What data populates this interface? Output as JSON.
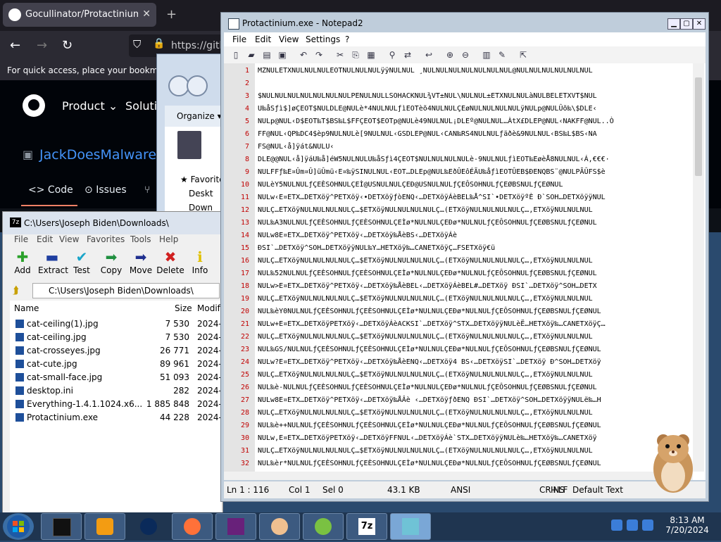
{
  "browser": {
    "tab_title": "Gocullinator/Protactinium.exe",
    "new_tab": "+",
    "url": "https://gith",
    "bookmarks_hint": "For quick access, place your bookmarks",
    "github": {
      "product": "Product",
      "solutions": "Solutio",
      "repo_owner": "JackDoesMalwares",
      "tabs": [
        "Code",
        "Issues"
      ]
    }
  },
  "explorer": {
    "organize": "Organize",
    "favorites": "Favorite",
    "desktop": "Deskt",
    "downloads": "Down"
  },
  "zip": {
    "title": "C:\\Users\\Joseph Biden\\Downloads\\",
    "icon_text": "7z",
    "menu": [
      "File",
      "Edit",
      "View",
      "Favorites",
      "Tools",
      "Help"
    ],
    "tools": [
      {
        "label": "Add",
        "icon": "plus-icon",
        "color": "#2aa12a"
      },
      {
        "label": "Extract",
        "icon": "minus-icon",
        "color": "#1f3fa0"
      },
      {
        "label": "Test",
        "icon": "check-icon",
        "color": "#1aa5c9"
      },
      {
        "label": "Copy",
        "icon": "copy-arrow-icon",
        "color": "#1f8f3f"
      },
      {
        "label": "Move",
        "icon": "move-arrow-icon",
        "color": "#1f2f8f"
      },
      {
        "label": "Delete",
        "icon": "delete-x-icon",
        "color": "#d02020"
      },
      {
        "label": "Info",
        "icon": "info-icon",
        "color": "#e0c000"
      }
    ],
    "path": "C:\\Users\\Joseph Biden\\Downloads\\",
    "columns": {
      "name": "Name",
      "size": "Size",
      "modified": "Modif"
    },
    "files": [
      {
        "name": "cat-ceiling(1).jpg",
        "size": "7 530",
        "date": "2024-"
      },
      {
        "name": "cat-ceiling.jpg",
        "size": "7 530",
        "date": "2024-"
      },
      {
        "name": "cat-crosseyes.jpg",
        "size": "26 771",
        "date": "2024-"
      },
      {
        "name": "cat-cute.jpg",
        "size": "89 961",
        "date": "2024-"
      },
      {
        "name": "cat-small-face.jpg",
        "size": "51 093",
        "date": "2024-"
      },
      {
        "name": "desktop.ini",
        "size": "282",
        "date": "2024-"
      },
      {
        "name": "Everything-1.4.1.1024.x6...",
        "size": "1 885 848",
        "date": "2024-"
      },
      {
        "name": "Protactinium.exe",
        "size": "44 228",
        "date": "2024-"
      }
    ]
  },
  "notepad": {
    "title": "Protactinium.exe - Notepad2",
    "menu": [
      "File",
      "Edit",
      "View",
      "Settings",
      "?"
    ],
    "lines": [
      {
        "n": "1",
        "text": "MZNULETXNULNULNULEOTNULNULNULÿÿNULNUL ¸NULNULNULNULNULNULNUL@NULNULNULNULNULNUL"
      },
      {
        "n": "2",
        "text": ""
      },
      {
        "n": "3",
        "text": "$NULNULNULNULNULNULNULPENULNULLSOHACKNUL¾VT±NUL\\NULNUL±ETXNULNULàNULBELETXVT$NUL"
      },
      {
        "n": "4",
        "text": "U‰åSƒì$]øÇEOT$NULDLE@NULè*4NULNULƒìEOTèõ4NULNULÇEøNULNULNULNULÿNULp@NULÛõ‰\\$DLE‹"
      },
      {
        "n": "5",
        "text": "NULp@NUL‹D$EOT‰T$BS‰L$FFÇEOT$EOTp@NULè49NULNUL¡DLEº@NULNUL…ÀtX£DLEP@NUL‹NAKFF@NUL..Ò"
      },
      {
        "n": "6",
        "text": "FF@NUL‹QP‰DC4$èp9NULNULè[9NULNUL‹GSDLEP@NUL‹CAN‰RS4NULNULƒäðè&9NULNUL‹BS‰L$BS‹NA"
      },
      {
        "n": "7",
        "text": "FS@NUL‹å]ÿát&NULU‹"
      },
      {
        "n": "8",
        "text": "DLE@@NUL‹å]ÿáU‰å]éW5NULNULU‰åSƒì4ÇEOT$NULNULNULNULè-9NULNULƒìEOT‰EøèÅ8NULNUL‹Á,€€€·"
      },
      {
        "n": "9",
        "text": "NULFFƒ‰E¤Ûm¤Û]üÛmü‹E¤‰ÿSINULNUL‹EOT…DLEp@NUL‰EðÛEôÉÃU‰åƒìEOTÛEB$ÐENQBS¨@NULPÃÛFS$è"
      },
      {
        "n": "10",
        "text": "NULèY5NULNULƒÇEÈSOHNULÇEÌ@USNULNULÇEÐ@USNULNULƒÇEÔSOHNULƒÇEØBSNULƒÇEØNUL"
      },
      {
        "n": "11",
        "text": "NULw‹E¤ETX…DETXöÿ^PETXöÿ‹•DETXöÿƒòENQ‹…DETXöÿÁèBEL‰Å^SI`•DETXöÿºÈ Ð`SOH…DETXöÿÿNUL"
      },
      {
        "n": "12",
        "text": "NULÇ…ETXöÿNULNULNULNULÇ…$ETXöÿNULNULNULNULÇ…(ETXöÿNULNULNULNULÇ…,ETXöÿNULNULNUL"
      },
      {
        "n": "13",
        "text": "NUL‰A3NULNULƒÇEÈSOHNULƒÇEÈSOHNULÇEÌø*NULNULÇEÐø*NULNULƒÇEÔSOHNULƒÇEØBSNULƒÇEØNUL"
      },
      {
        "n": "14",
        "text": "NULw8E¤ETX…DETXöÿ^PETXöÿ‹…DETXöÿ‰ÅèBS‹…DETXöÿÁè"
      },
      {
        "n": "15",
        "text": "   ÐSI`…DETXöÿ^SOH…DETXöÿÿNUL‰Y…HETXöÿ‰…CANETXöÿÇ…FSETXöÿ€ü"
      },
      {
        "n": "16",
        "text": "NULÇ…ETXöÿNULNULNULNULÇ…$ETXöÿNULNULNULNULÇ…(ETXöÿNULNULNULNULÇ…,ETXöÿNULNULNUL"
      },
      {
        "n": "17",
        "text": "NUL‰52NULNULƒÇEÈSOHNULƒÇEÈSOHNULÇEÌø*NULNULÇEÐø*NULNULƒÇEÔSOHNULƒÇEØBSNULƒÇEØNUL"
      },
      {
        "n": "18",
        "text": "NULw>E¤ETX…DETXöÿ^PETXöÿ‹…DETXöÿ‰ÅèBEL‹…DETXöÿÁèBEL#…DETXöÿ  ÐSI`…DETXöÿ^SOH…DETX"
      },
      {
        "n": "19",
        "text": "NULÇ…ETXöÿNULNULNULNULÇ…$ETXöÿNULNULNULNULÇ…(ETXöÿNULNULNULNULÇ…,ETXöÿNULNULNUL"
      },
      {
        "n": "20",
        "text": "NUL‰èY0NULNULƒÇEÈSOHNULƒÇEÈSOHNULÇEÌø*NULNULÇEÐø*NULNULƒÇEÔSOHNULƒÇEØBSNULƒÇEØNUL"
      },
      {
        "n": "21",
        "text": "NULw+E¤ETX…DETXöÿPETXöÿ‹…DETXöÿÁèACKSI`…DETXöÿ^STX…DETXöÿÿNULèË…HETXöÿ‰…CANETXöÿÇ…"
      },
      {
        "n": "22",
        "text": "NULÇ…ETXöÿNULNULNULNULÇ…$ETXöÿNULNULNULNULÇ…(ETXöÿNULNULNULNULÇ…,ETXöÿNULNULNUL"
      },
      {
        "n": "23",
        "text": "NUL‰GS/NULNULƒÇEÈSOHNULƒÇEÈSOHNULÇEÌø*NULNULÇEÐø*NULNULƒÇEÔSOHNULƒÇEØBSNULƒÇEØNUL"
      },
      {
        "n": "24",
        "text": "NULw?E¤ETX…DETXöÿ^PETXöÿ‹…DETXöÿ‰ÅèENQ‹…DETXöÿ4 BS‹…DETXöÿSI`…DETXöÿ Ð^SOH…DETXöÿ"
      },
      {
        "n": "25",
        "text": "NULÇ…ETXöÿNULNULNULNULÇ…$ETXöÿNULNULNULNULÇ…(ETXöÿNULNULNULNULÇ…,ETXöÿNULNULNUL"
      },
      {
        "n": "26",
        "text": "NUL‰è‑NULNULƒÇEÈSOHNULƒÇEÈSOHNULÇEÌø*NULNULÇEÐø*NULNULƒÇEÔSOHNULƒÇEØBSNULƒÇEØNUL"
      },
      {
        "n": "27",
        "text": "NULw8E¤ETX…DETXöÿ^PETXöÿ‹…DETXöÿ‰ÅÂè  ‹…DETXöÿƒðENQ  ÐSI`…DETXöÿ^SOH…DETXöÿÿNULë‰…H"
      },
      {
        "n": "28",
        "text": "NULÇ…ETXöÿNULNULNULNULÇ…$ETXöÿNULNULNULNULÇ…(ETXöÿNULNULNULNULÇ…,ETXöÿNULNULNUL"
      },
      {
        "n": "29",
        "text": "NUL‰è++NULNULƒÇEÈSOHNULƒÇEÈSOHNULÇEÌø*NULNULÇEÐø*NULNULƒÇEÔSOHNULƒÇEØBSNULƒÇEØNUL"
      },
      {
        "n": "30",
        "text": "NULw,E¤ETX…DETXöÿPETXöÿ‹…DETXöÿFFNUL‹…DETXöÿÁè`STX…DETXöÿÿNULè‰…HETXöÿ‰…CANETXöÿ"
      },
      {
        "n": "31",
        "text": "NULÇ…ETXöÿNULNULNULNULÇ…$ETXöÿNULNULNULNULÇ…(ETXöÿNULNULNULNULÇ…,ETXöÿNULNULNUL"
      },
      {
        "n": "32",
        "text": "NUL‰èr*NULNULƒÇEÈSOHNULƒÇEÈSOHNULÇEÌø*NULNULÇEÐø*NULNULƒÇEÔSOHNULƒÇEØBSNULƒÇEØNUL"
      }
    ],
    "status": {
      "position": "Ln 1 : 116",
      "col": "Col 1",
      "sel": "Sel 0",
      "size": "43.1 KB",
      "encoding": "ANSI",
      "eol": "CR+LF",
      "ins": "INS",
      "scheme": "Default Text"
    }
  },
  "taskbar": {
    "time": "8:13 AM",
    "date": "7/20/2024",
    "apps": [
      "terminal-icon",
      "media-player-icon",
      "globe-icon",
      "firefox-icon",
      "visual-studio-icon",
      "user-icon",
      "lime-icon",
      "7zip-icon",
      "notepad-icon"
    ],
    "app_7zip_label": "7z"
  }
}
